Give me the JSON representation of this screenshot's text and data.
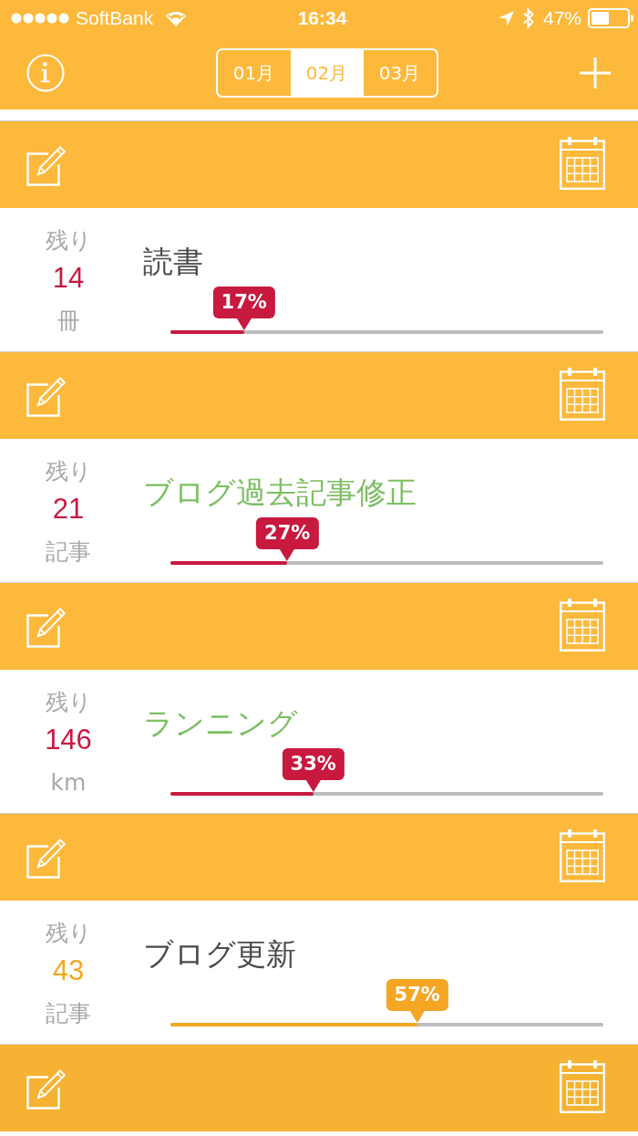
{
  "status_bar": {
    "carrier": "SoftBank",
    "time": "16:34",
    "battery": "47%"
  },
  "nav": {
    "months": [
      {
        "label": "01月",
        "selected": false
      },
      {
        "label": "02月",
        "selected": true
      },
      {
        "label": "03月",
        "selected": false
      }
    ]
  },
  "goals": [
    {
      "remaining_label": "残り",
      "remaining": "14",
      "unit": "冊",
      "title": {
        "text": "読書",
        "color": "#4a4a4a"
      },
      "color": "#c8193f",
      "percent": "17%",
      "level": 0.17
    },
    {
      "remaining_label": "残り",
      "remaining": "21",
      "unit": "記事",
      "title": {
        "text": "ブログ過去記事修正",
        "color": "#7dbf62"
      },
      "color": "#c8193f",
      "percent": "27%",
      "level": 0.27
    },
    {
      "remaining_label": "残り",
      "remaining": "146",
      "unit": "km",
      "title": {
        "text": "ランニング",
        "color": "#7dbf62"
      },
      "color": "#c8193f",
      "percent": "33%",
      "level": 0.33
    },
    {
      "remaining_label": "残り",
      "remaining": "43",
      "unit": "記事",
      "title": {
        "text": "ブログ更新",
        "color": "#4a4a4a"
      },
      "color": "#f5a623",
      "percent": "57%",
      "level": 0.57
    }
  ],
  "partial_card_below": true
}
